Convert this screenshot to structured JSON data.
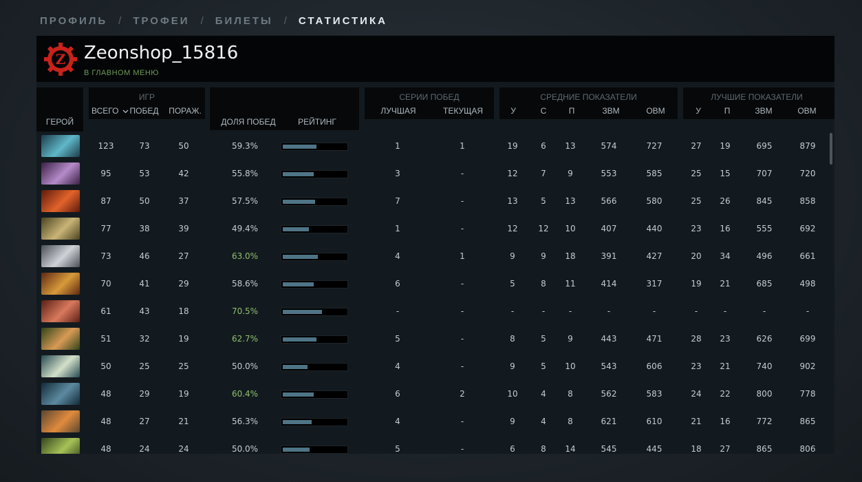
{
  "breadcrumb": [
    {
      "label": "ПРОФИЛЬ",
      "active": false
    },
    {
      "label": "ТРОФЕИ",
      "active": false
    },
    {
      "label": "БИЛЕТЫ",
      "active": false
    },
    {
      "label": "СТАТИСТИКА",
      "active": true
    }
  ],
  "breadcrumb_separator": "/",
  "profile": {
    "logo_letter": "Z",
    "username": "Zeonshop_15816",
    "status": "В ГЛАВНОМ МЕНЮ"
  },
  "colors": {
    "accent_red": "#c8221a",
    "status_green": "#6d9a56",
    "winrate_green": "#8fbf6f",
    "bar_fill": "#4e7486"
  },
  "headers": {
    "hero": "ГЕРОЙ",
    "games_group": "ИГР",
    "total": "ВСЕГО",
    "wins": "ПОБЕД",
    "losses": "ПОРАЖ.",
    "winrate": "ДОЛЯ ПОБЕД",
    "rating": "РЕЙТИНГ",
    "streaks_group": "СЕРИИ ПОБЕД",
    "best_streak": "ЛУЧШАЯ",
    "current_streak": "ТЕКУЩАЯ",
    "avg_group": "СРЕДНИЕ ПОКАЗАТЕЛИ",
    "best_group": "ЛУЧШИЕ ПОКАЗАТЕЛИ",
    "kills": "У",
    "deaths": "С",
    "assists": "П",
    "gpm": "ЗВМ",
    "xpm": "ОВМ",
    "sort_icon": "chevron-down-icon"
  },
  "rows": [
    {
      "hero_icon": "hero-portrait-icon",
      "colors": [
        "#1d3d4a",
        "#5fb7c9"
      ],
      "total": "123",
      "wins": "73",
      "losses": "50",
      "winrate": "59.3%",
      "winrate_green": false,
      "rating": 0.52,
      "best_streak": "1",
      "current_streak": "1",
      "avg_k": "19",
      "avg_d": "6",
      "avg_a": "13",
      "avg_gpm": "574",
      "avg_xpm": "727",
      "best_k": "27",
      "best_a": "19",
      "best_gpm": "695",
      "best_xpm": "879"
    },
    {
      "hero_icon": "hero-portrait-icon",
      "colors": [
        "#3a2045",
        "#b58bc9"
      ],
      "total": "95",
      "wins": "53",
      "losses": "42",
      "winrate": "55.8%",
      "winrate_green": false,
      "rating": 0.48,
      "best_streak": "3",
      "current_streak": "-",
      "avg_k": "12",
      "avg_d": "7",
      "avg_a": "9",
      "avg_gpm": "553",
      "avg_xpm": "585",
      "best_k": "25",
      "best_a": "15",
      "best_gpm": "707",
      "best_xpm": "720"
    },
    {
      "hero_icon": "hero-portrait-icon",
      "colors": [
        "#5a1a0c",
        "#e2632a"
      ],
      "total": "87",
      "wins": "50",
      "losses": "37",
      "winrate": "57.5%",
      "winrate_green": false,
      "rating": 0.5,
      "best_streak": "7",
      "current_streak": "-",
      "avg_k": "13",
      "avg_d": "5",
      "avg_a": "13",
      "avg_gpm": "566",
      "avg_xpm": "580",
      "best_k": "25",
      "best_a": "26",
      "best_gpm": "845",
      "best_xpm": "858"
    },
    {
      "hero_icon": "hero-portrait-icon",
      "colors": [
        "#4a4320",
        "#c9b477"
      ],
      "total": "77",
      "wins": "38",
      "losses": "39",
      "winrate": "49.4%",
      "winrate_green": false,
      "rating": 0.4,
      "best_streak": "1",
      "current_streak": "-",
      "avg_k": "12",
      "avg_d": "12",
      "avg_a": "10",
      "avg_gpm": "407",
      "avg_xpm": "440",
      "best_k": "23",
      "best_a": "16",
      "best_gpm": "555",
      "best_xpm": "692"
    },
    {
      "hero_icon": "hero-portrait-icon",
      "colors": [
        "#4a4e55",
        "#cfd3d8"
      ],
      "total": "73",
      "wins": "46",
      "losses": "27",
      "winrate": "63.0%",
      "winrate_green": true,
      "rating": 0.54,
      "best_streak": "4",
      "current_streak": "1",
      "avg_k": "9",
      "avg_d": "9",
      "avg_a": "18",
      "avg_gpm": "391",
      "avg_xpm": "427",
      "best_k": "20",
      "best_a": "34",
      "best_gpm": "496",
      "best_xpm": "661"
    },
    {
      "hero_icon": "hero-portrait-icon",
      "colors": [
        "#5e2812",
        "#d79a3a"
      ],
      "total": "70",
      "wins": "41",
      "losses": "29",
      "winrate": "58.6%",
      "winrate_green": false,
      "rating": 0.48,
      "best_streak": "6",
      "current_streak": "-",
      "avg_k": "5",
      "avg_d": "8",
      "avg_a": "11",
      "avg_gpm": "414",
      "avg_xpm": "317",
      "best_k": "19",
      "best_a": "21",
      "best_gpm": "685",
      "best_xpm": "498"
    },
    {
      "hero_icon": "hero-portrait-icon",
      "colors": [
        "#5a1f14",
        "#d8795d"
      ],
      "total": "61",
      "wins": "43",
      "losses": "18",
      "winrate": "70.5%",
      "winrate_green": true,
      "rating": 0.61,
      "best_streak": "-",
      "current_streak": "-",
      "avg_k": "-",
      "avg_d": "-",
      "avg_a": "-",
      "avg_gpm": "-",
      "avg_xpm": "-",
      "best_k": "-",
      "best_a": "-",
      "best_gpm": "-",
      "best_xpm": "-"
    },
    {
      "hero_icon": "hero-portrait-icon",
      "colors": [
        "#2f4418",
        "#d99a55"
      ],
      "total": "51",
      "wins": "32",
      "losses": "19",
      "winrate": "62.7%",
      "winrate_green": true,
      "rating": 0.52,
      "best_streak": "5",
      "current_streak": "-",
      "avg_k": "8",
      "avg_d": "5",
      "avg_a": "9",
      "avg_gpm": "443",
      "avg_xpm": "471",
      "best_k": "28",
      "best_a": "23",
      "best_gpm": "626",
      "best_xpm": "699"
    },
    {
      "hero_icon": "hero-portrait-icon",
      "colors": [
        "#274a52",
        "#d3e0c9"
      ],
      "total": "50",
      "wins": "25",
      "losses": "25",
      "winrate": "50.0%",
      "winrate_green": false,
      "rating": 0.38,
      "best_streak": "4",
      "current_streak": "-",
      "avg_k": "9",
      "avg_d": "5",
      "avg_a": "10",
      "avg_gpm": "543",
      "avg_xpm": "606",
      "best_k": "23",
      "best_a": "21",
      "best_gpm": "740",
      "best_xpm": "902"
    },
    {
      "hero_icon": "hero-portrait-icon",
      "colors": [
        "#122a38",
        "#5d8aa0"
      ],
      "total": "48",
      "wins": "29",
      "losses": "19",
      "winrate": "60.4%",
      "winrate_green": true,
      "rating": 0.48,
      "best_streak": "6",
      "current_streak": "2",
      "avg_k": "10",
      "avg_d": "4",
      "avg_a": "8",
      "avg_gpm": "562",
      "avg_xpm": "583",
      "best_k": "24",
      "best_a": "22",
      "best_gpm": "800",
      "best_xpm": "778"
    },
    {
      "hero_icon": "hero-portrait-icon",
      "colors": [
        "#5a4630",
        "#e08b3e"
      ],
      "total": "48",
      "wins": "27",
      "losses": "21",
      "winrate": "56.3%",
      "winrate_green": false,
      "rating": 0.45,
      "best_streak": "4",
      "current_streak": "-",
      "avg_k": "9",
      "avg_d": "4",
      "avg_a": "8",
      "avg_gpm": "621",
      "avg_xpm": "610",
      "best_k": "21",
      "best_a": "16",
      "best_gpm": "772",
      "best_xpm": "865"
    },
    {
      "hero_icon": "hero-portrait-icon",
      "colors": [
        "#33441c",
        "#a7c257"
      ],
      "total": "48",
      "wins": "24",
      "losses": "24",
      "winrate": "50.0%",
      "winrate_green": false,
      "rating": 0.42,
      "best_streak": "5",
      "current_streak": "-",
      "avg_k": "6",
      "avg_d": "8",
      "avg_a": "14",
      "avg_gpm": "545",
      "avg_xpm": "445",
      "best_k": "18",
      "best_a": "27",
      "best_gpm": "865",
      "best_xpm": "806"
    }
  ]
}
